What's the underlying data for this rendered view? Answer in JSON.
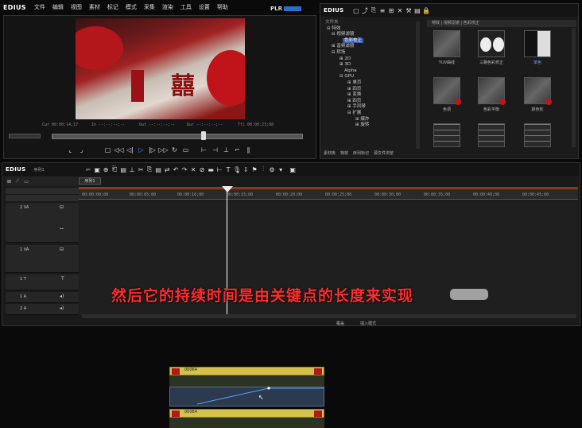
{
  "app": {
    "name": "EDIUS"
  },
  "menu": [
    "文件",
    "编辑",
    "视图",
    "素材",
    "标记",
    "模式",
    "采集",
    "渲染",
    "工具",
    "设置",
    "帮助"
  ],
  "player": {
    "badge": "PLR",
    "labels": {
      "cur": "Cur",
      "in": "In",
      "out": "Out",
      "dur": "Dur",
      "ttl": "Ttl"
    },
    "timecodes": {
      "cur": "00:00:14;17",
      "in": "--:--:--;--",
      "out": "--:--:--;--",
      "dur": "--:--:--;--",
      "ttl": "00:00:23;08"
    }
  },
  "bin": {
    "title": "EDIUS",
    "tree_header": "文件夹",
    "tree": [
      "特效",
      "视频滤镜",
      "色彩校正",
      "音频滤镜",
      "转场",
      "2D",
      "3D",
      "Alpha",
      "GPU",
      "单页",
      "四页",
      "变换",
      "四页",
      "手风琴",
      "扩展",
      "爆炸",
      "旋转"
    ],
    "tree_path": "特效 | 视频滤镜 | 色彩校正",
    "thumbs": [
      "YUV曲线",
      "三路色彩校正",
      "单色",
      "色调",
      "色彩平衡",
      "颜色轮",
      "",
      ""
    ],
    "tabs": [
      "素材库",
      "特效",
      "序列标记",
      "源文件浏览"
    ]
  },
  "timeline": {
    "title": "EDIUS",
    "sequence": "序列1",
    "sequence_tab": "序列1",
    "ruler": [
      "00:00:00;00",
      "00:00:05;00",
      "00:00:10;00",
      "00:00:15;00",
      "00:00:20;00",
      "00:00:25;00",
      "00:00:30;00",
      "00:00:35;00",
      "00:00:40;00",
      "00:00:45;00"
    ],
    "tracks": [
      {
        "name": "2 VA",
        "type": "va"
      },
      {
        "name": "1 VA",
        "type": "va"
      },
      {
        "name": "1 T",
        "type": "t"
      },
      {
        "name": "1 A",
        "type": "a"
      },
      {
        "name": "2 A",
        "type": "a"
      }
    ],
    "clip_name": "00064",
    "status": {
      "insert": "插入模式",
      "ratio": "覆盖"
    }
  },
  "caption": "然后它的持续时间是由关键点的长度来实现",
  "colors": {
    "caption": "#ff2d2d",
    "clip": "#d4c24a",
    "playhead": "#ffffff"
  }
}
